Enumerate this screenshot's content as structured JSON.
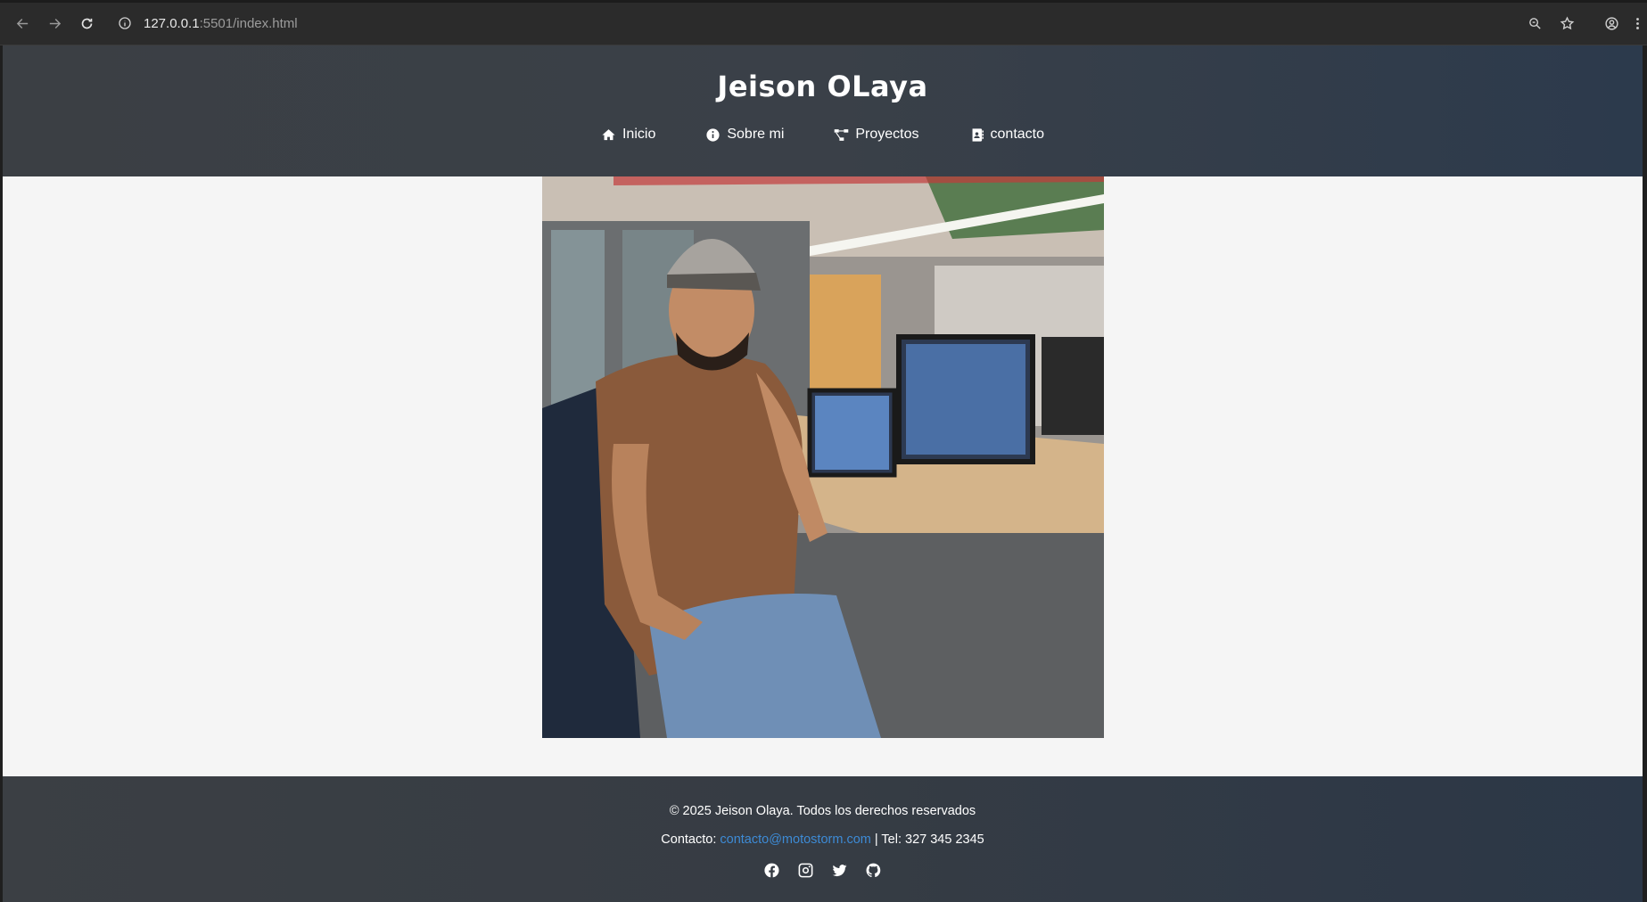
{
  "browser": {
    "url_host": "127.0.0.1",
    "url_rest": ":5501/index.html"
  },
  "site": {
    "title": "Jeison OLaya",
    "nav": [
      {
        "label": "Inicio",
        "icon": "home-icon"
      },
      {
        "label": "Sobre mi",
        "icon": "info-icon"
      },
      {
        "label": "Proyectos",
        "icon": "project-diagram-icon"
      },
      {
        "label": "contacto",
        "icon": "address-book-icon"
      }
    ],
    "photo_icon": "profile-photo"
  },
  "footer": {
    "copyright": "© 2025 Jeison Olaya. Todos los derechos reservados",
    "contact_prefix": "Contacto: ",
    "email": "contacto@motostorm.com",
    "phone_text": " | Tel: 327 345 2345",
    "socials": [
      "facebook-icon",
      "instagram-icon",
      "twitter-icon",
      "github-icon"
    ]
  },
  "colors": {
    "header_start": "#3b3f44",
    "header_end": "#2c3a4c",
    "page_bg": "#f5f5f5",
    "link": "#3d8bd6"
  }
}
